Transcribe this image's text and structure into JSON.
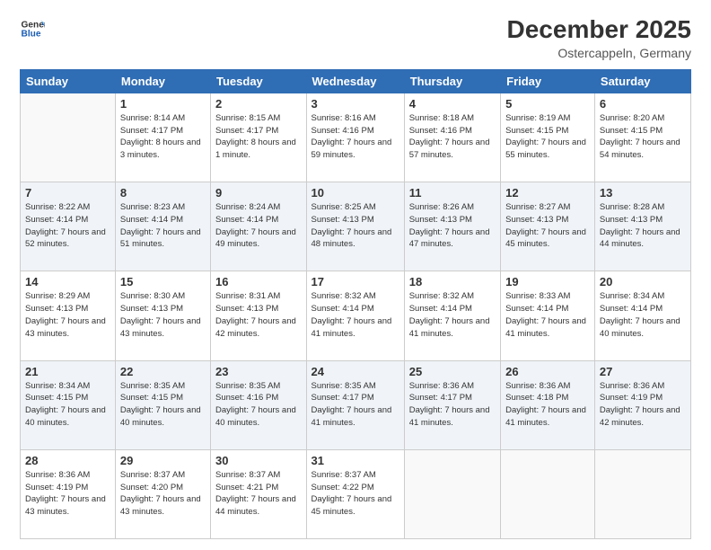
{
  "header": {
    "logo_line1": "General",
    "logo_line2": "Blue",
    "month": "December 2025",
    "location": "Ostercappeln, Germany"
  },
  "days_of_week": [
    "Sunday",
    "Monday",
    "Tuesday",
    "Wednesday",
    "Thursday",
    "Friday",
    "Saturday"
  ],
  "weeks": [
    [
      {
        "day": "",
        "info": ""
      },
      {
        "day": "1",
        "info": "Sunrise: 8:14 AM\nSunset: 4:17 PM\nDaylight: 8 hours\nand 3 minutes."
      },
      {
        "day": "2",
        "info": "Sunrise: 8:15 AM\nSunset: 4:17 PM\nDaylight: 8 hours\nand 1 minute."
      },
      {
        "day": "3",
        "info": "Sunrise: 8:16 AM\nSunset: 4:16 PM\nDaylight: 7 hours\nand 59 minutes."
      },
      {
        "day": "4",
        "info": "Sunrise: 8:18 AM\nSunset: 4:16 PM\nDaylight: 7 hours\nand 57 minutes."
      },
      {
        "day": "5",
        "info": "Sunrise: 8:19 AM\nSunset: 4:15 PM\nDaylight: 7 hours\nand 55 minutes."
      },
      {
        "day": "6",
        "info": "Sunrise: 8:20 AM\nSunset: 4:15 PM\nDaylight: 7 hours\nand 54 minutes."
      }
    ],
    [
      {
        "day": "7",
        "info": "Sunrise: 8:22 AM\nSunset: 4:14 PM\nDaylight: 7 hours\nand 52 minutes."
      },
      {
        "day": "8",
        "info": "Sunrise: 8:23 AM\nSunset: 4:14 PM\nDaylight: 7 hours\nand 51 minutes."
      },
      {
        "day": "9",
        "info": "Sunrise: 8:24 AM\nSunset: 4:14 PM\nDaylight: 7 hours\nand 49 minutes."
      },
      {
        "day": "10",
        "info": "Sunrise: 8:25 AM\nSunset: 4:13 PM\nDaylight: 7 hours\nand 48 minutes."
      },
      {
        "day": "11",
        "info": "Sunrise: 8:26 AM\nSunset: 4:13 PM\nDaylight: 7 hours\nand 47 minutes."
      },
      {
        "day": "12",
        "info": "Sunrise: 8:27 AM\nSunset: 4:13 PM\nDaylight: 7 hours\nand 45 minutes."
      },
      {
        "day": "13",
        "info": "Sunrise: 8:28 AM\nSunset: 4:13 PM\nDaylight: 7 hours\nand 44 minutes."
      }
    ],
    [
      {
        "day": "14",
        "info": "Sunrise: 8:29 AM\nSunset: 4:13 PM\nDaylight: 7 hours\nand 43 minutes."
      },
      {
        "day": "15",
        "info": "Sunrise: 8:30 AM\nSunset: 4:13 PM\nDaylight: 7 hours\nand 43 minutes."
      },
      {
        "day": "16",
        "info": "Sunrise: 8:31 AM\nSunset: 4:13 PM\nDaylight: 7 hours\nand 42 minutes."
      },
      {
        "day": "17",
        "info": "Sunrise: 8:32 AM\nSunset: 4:14 PM\nDaylight: 7 hours\nand 41 minutes."
      },
      {
        "day": "18",
        "info": "Sunrise: 8:32 AM\nSunset: 4:14 PM\nDaylight: 7 hours\nand 41 minutes."
      },
      {
        "day": "19",
        "info": "Sunrise: 8:33 AM\nSunset: 4:14 PM\nDaylight: 7 hours\nand 41 minutes."
      },
      {
        "day": "20",
        "info": "Sunrise: 8:34 AM\nSunset: 4:14 PM\nDaylight: 7 hours\nand 40 minutes."
      }
    ],
    [
      {
        "day": "21",
        "info": "Sunrise: 8:34 AM\nSunset: 4:15 PM\nDaylight: 7 hours\nand 40 minutes."
      },
      {
        "day": "22",
        "info": "Sunrise: 8:35 AM\nSunset: 4:15 PM\nDaylight: 7 hours\nand 40 minutes."
      },
      {
        "day": "23",
        "info": "Sunrise: 8:35 AM\nSunset: 4:16 PM\nDaylight: 7 hours\nand 40 minutes."
      },
      {
        "day": "24",
        "info": "Sunrise: 8:35 AM\nSunset: 4:17 PM\nDaylight: 7 hours\nand 41 minutes."
      },
      {
        "day": "25",
        "info": "Sunrise: 8:36 AM\nSunset: 4:17 PM\nDaylight: 7 hours\nand 41 minutes."
      },
      {
        "day": "26",
        "info": "Sunrise: 8:36 AM\nSunset: 4:18 PM\nDaylight: 7 hours\nand 41 minutes."
      },
      {
        "day": "27",
        "info": "Sunrise: 8:36 AM\nSunset: 4:19 PM\nDaylight: 7 hours\nand 42 minutes."
      }
    ],
    [
      {
        "day": "28",
        "info": "Sunrise: 8:36 AM\nSunset: 4:19 PM\nDaylight: 7 hours\nand 43 minutes."
      },
      {
        "day": "29",
        "info": "Sunrise: 8:37 AM\nSunset: 4:20 PM\nDaylight: 7 hours\nand 43 minutes."
      },
      {
        "day": "30",
        "info": "Sunrise: 8:37 AM\nSunset: 4:21 PM\nDaylight: 7 hours\nand 44 minutes."
      },
      {
        "day": "31",
        "info": "Sunrise: 8:37 AM\nSunset: 4:22 PM\nDaylight: 7 hours\nand 45 minutes."
      },
      {
        "day": "",
        "info": ""
      },
      {
        "day": "",
        "info": ""
      },
      {
        "day": "",
        "info": ""
      }
    ]
  ]
}
